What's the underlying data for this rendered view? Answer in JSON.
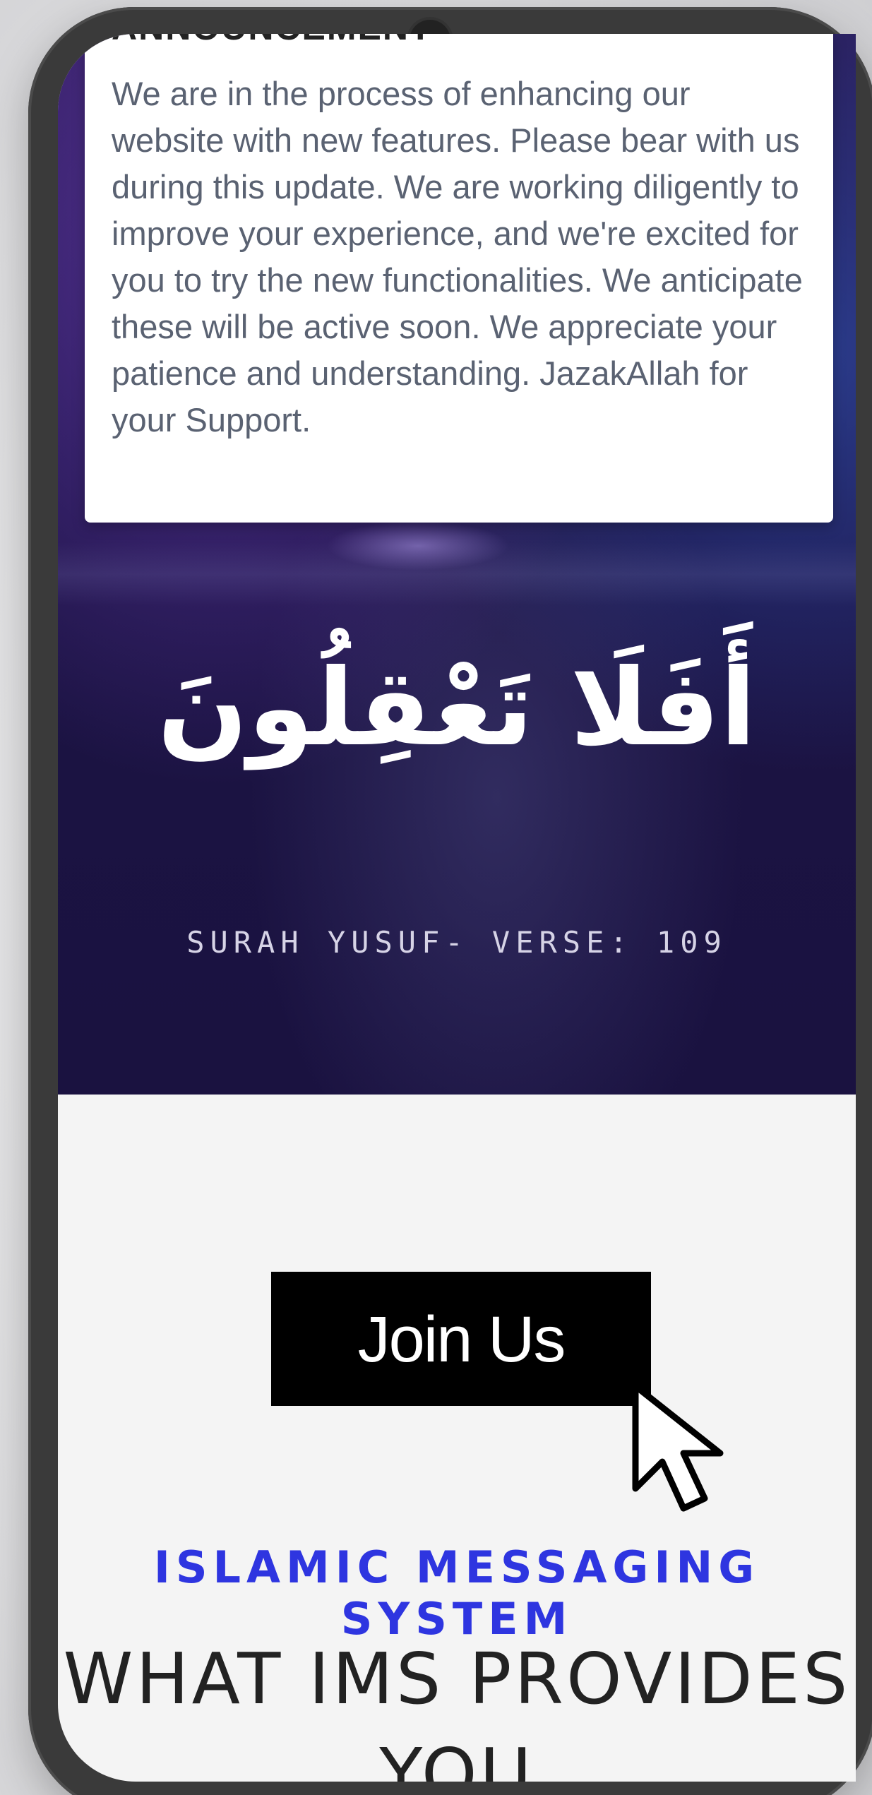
{
  "announcement": {
    "title": "ANNOUNCEMENT",
    "body": "We are in the process of enhancing our website with new features. Please bear with us during this update. We are working diligently to improve your experience, and we're excited for you to try the new functionalities. We anticipate these will be active soon. We appreciate your patience and understanding. JazakAllah for your Support."
  },
  "hero": {
    "arabic_text": "أَفَلَا تَعْقِلُونَ",
    "verse_reference": "SURAH YUSUF- VERSE: 109"
  },
  "cta": {
    "join_label": "Join Us"
  },
  "features": {
    "eyebrow": "ISLAMIC MESSAGING SYSTEM",
    "heading": "WHAT IMS PROVIDES YOU"
  },
  "colors": {
    "accent_blue": "#2e35e0",
    "hero_bg": "#1e1448",
    "button_bg": "#000000",
    "section_bg": "#f4f4f4"
  },
  "icons": {
    "pointer": "mouse-pointer-icon"
  }
}
